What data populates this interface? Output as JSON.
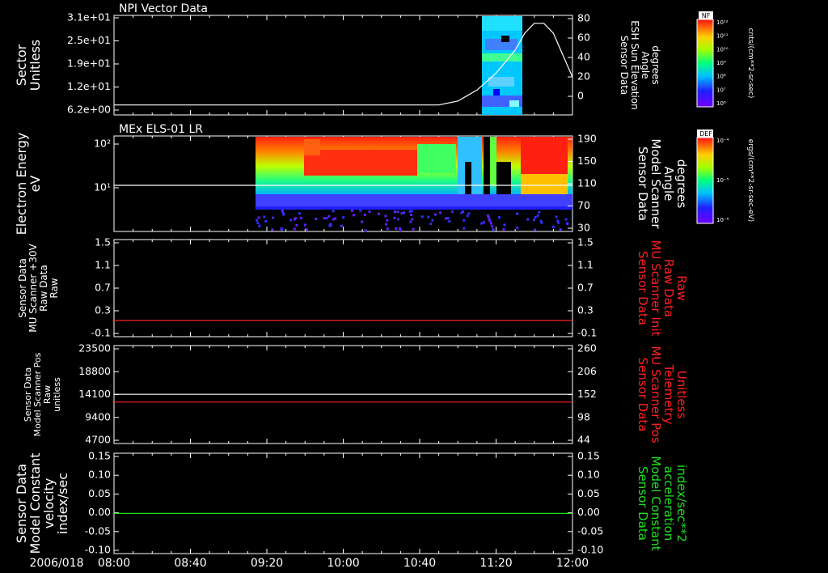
{
  "colors": {
    "background": "#000000",
    "axis": "#ffffff",
    "red": "#ff2020",
    "green": "#20e020"
  },
  "time_axis": {
    "date_label": "2006/018",
    "ticks": [
      "08:00",
      "08:40",
      "09:20",
      "10:00",
      "10:40",
      "11:20",
      "12:00"
    ],
    "range_minutes": [
      480,
      720
    ]
  },
  "panels": [
    {
      "title": "NPI Vector Data",
      "left_label": [
        "Sector",
        "Unitless"
      ],
      "left_ticks": [
        "3.1e+01",
        "2.5e+01",
        "1.9e+01",
        "1.2e+01",
        "6.2e+00"
      ],
      "right_label": [
        "Sensor Data",
        "ESH Sun Elevation",
        "Angle",
        "degrees"
      ],
      "right_label_color": "#ffffff",
      "right_ticks": [
        "80",
        "60",
        "40",
        "20",
        "0"
      ],
      "colorbar": {
        "tag": "NF",
        "units": "cnts/(cm**2-sr-sec)",
        "ticks": [
          "10¹²",
          "10¹¹",
          "10¹⁰",
          "10⁹",
          "10⁸",
          "10⁷",
          "10⁶"
        ]
      }
    },
    {
      "title": "MEx ELS-01 LR",
      "left_label": [
        "Electron Energy",
        "eV"
      ],
      "left_ticks": [
        "10²",
        "10¹"
      ],
      "right_label": [
        "Sensor Data",
        "Model Scanner",
        "Angle",
        "degrees"
      ],
      "right_label_color": "#ffffff",
      "right_ticks": [
        "190",
        "150",
        "110",
        "70",
        "30"
      ],
      "colorbar": {
        "tag": "DEF",
        "units": "ergs/(cm**2-sr-sec-eV)",
        "ticks": [
          "10⁻⁴",
          "10⁻⁵",
          "10⁻⁶"
        ]
      }
    },
    {
      "left_label": [
        "Sensor Data",
        "MU Scanner +30V",
        "Raw Data",
        "Raw"
      ],
      "left_ticks": [
        "1.5",
        "1.1",
        "0.7",
        "0.3",
        "-0.1"
      ],
      "right_label": [
        "Sensor Data",
        "MU Scanner Init",
        "Raw Data",
        "Raw"
      ],
      "right_label_color": "#ff2020",
      "right_ticks": [
        "1.5",
        "1.1",
        "0.7",
        "0.3",
        "-0.1"
      ]
    },
    {
      "left_label": [
        "Sensor Data",
        "Model Scanner Pos",
        "Raw",
        "unitless"
      ],
      "left_ticks": [
        "23500",
        "18800",
        "14100",
        "9400",
        "4700"
      ],
      "right_label": [
        "Sensor Data",
        "MU Scanner Pos",
        "Telemetry",
        "Unitless"
      ],
      "right_label_color": "#ff2020",
      "right_ticks": [
        "260",
        "206",
        "152",
        "98",
        "44"
      ]
    },
    {
      "left_label": [
        "Sensor Data",
        "Model Constant",
        "velocity",
        "index/sec"
      ],
      "left_ticks": [
        "0.15",
        "0.10",
        "0.05",
        "0.00",
        "-0.05",
        "-0.10"
      ],
      "right_label": [
        "Sensor Data",
        "Model Constant",
        "acceleration",
        "index/sec**2"
      ],
      "right_label_color": "#20e020",
      "right_ticks": [
        "0.15",
        "0.10",
        "0.05",
        "0.00",
        "-0.05",
        "-0.10"
      ]
    }
  ],
  "chart_data": [
    {
      "type": "line",
      "title": "NPI Vector Data",
      "series": [
        {
          "name": "Sensor Data ESH Sun Elevation Angle",
          "axis": "right",
          "color": "#ffffff",
          "x": [
            480,
            650,
            660,
            670,
            680,
            690,
            695,
            700,
            705,
            710,
            715,
            720
          ],
          "y": [
            -10,
            -10,
            -6,
            5,
            22,
            45,
            62,
            72,
            72,
            62,
            40,
            18
          ]
        }
      ],
      "spectrogram_minutes": [
        665,
        685
      ],
      "right_ylim": [
        -20,
        80
      ]
    },
    {
      "type": "heatmap",
      "title": "MEx ELS-01 LR",
      "y_unit": "eV",
      "data_interval_minutes": [
        548,
        720
      ],
      "series": [
        {
          "name": "Sensor Data Model Scanner Angle",
          "axis": "right",
          "color": "#ffffff",
          "x": [
            548,
            720
          ],
          "y": [
            97,
            97
          ]
        }
      ],
      "right_ylim": [
        10,
        190
      ]
    },
    {
      "type": "line",
      "series": [
        {
          "name": "Sensor Data MU Scanner Init Raw Data",
          "axis": "right",
          "color": "#ff2020",
          "x": [
            480,
            720
          ],
          "y": [
            0.0,
            0.0
          ]
        }
      ],
      "ylim": [
        -0.3,
        1.5
      ]
    },
    {
      "type": "line",
      "series": [
        {
          "name": "Sensor Data Model Scanner Pos",
          "axis": "left",
          "color": "#ffffff",
          "x": [
            480,
            720
          ],
          "y": [
            11800,
            11800
          ]
        },
        {
          "name": "Sensor Data MU Scanner Pos Telemetry",
          "axis": "right",
          "color": "#ff2020",
          "x": [
            480,
            720
          ],
          "y": [
            110,
            110
          ]
        }
      ],
      "ylim": [
        0,
        23500
      ],
      "right_ylim": [
        0,
        260
      ]
    },
    {
      "type": "line",
      "series": [
        {
          "name": "Sensor Data Model Constant velocity",
          "axis": "left",
          "color": "#20e020",
          "x": [
            480,
            720
          ],
          "y": [
            0.0,
            0.0
          ]
        }
      ],
      "ylim": [
        -0.1,
        0.15
      ]
    }
  ]
}
